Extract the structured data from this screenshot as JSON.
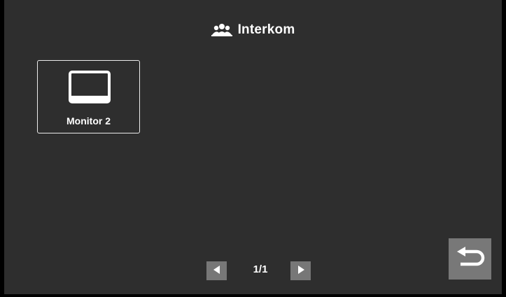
{
  "header": {
    "title": "Interkom",
    "icon": "users-group-icon"
  },
  "devices": [
    {
      "label": "Monitor 2",
      "icon": "monitor-icon"
    }
  ],
  "pagination": {
    "text": "1/1",
    "current": 1,
    "total": 1
  },
  "icons": {
    "prev": "triangle-left-icon",
    "next": "triangle-right-icon",
    "back": "return-arrow-icon"
  },
  "colors": {
    "background": "#2e2e2e",
    "button": "#777777",
    "text": "#ffffff",
    "tile_border": "#ececec"
  }
}
